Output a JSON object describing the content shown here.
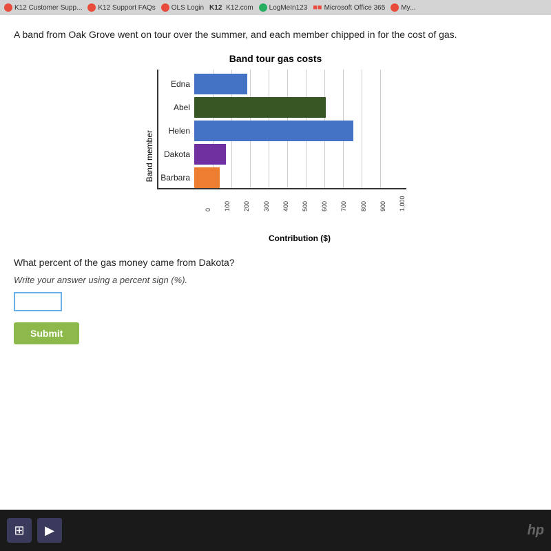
{
  "browser": {
    "tabs": [
      {
        "label": "K12 Customer Supp...",
        "icon": "k12-icon"
      },
      {
        "label": "K12 Support FAQs",
        "icon": "k12-icon2"
      },
      {
        "label": "OLS Login",
        "icon": "ols-icon"
      },
      {
        "label": "K12  K12.com",
        "icon": "k12-icon3"
      },
      {
        "label": "LogMeIn123",
        "icon": "logmein-icon"
      },
      {
        "label": "Microsoft Office 365",
        "icon": "ms-icon"
      },
      {
        "label": "My...",
        "icon": "my-icon"
      }
    ]
  },
  "problem": {
    "text": "A band from Oak Grove went on tour over the summer, and each member chipped in for the cost of gas."
  },
  "chart": {
    "title": "Band tour gas costs",
    "y_axis_label": "Band member",
    "x_axis_label": "Contribution ($)",
    "x_ticks": [
      "0",
      "100",
      "200",
      "300",
      "400",
      "500",
      "600",
      "700",
      "800",
      "900",
      "1,000"
    ],
    "members": [
      {
        "name": "Edna",
        "value": 250,
        "color": "#4472c4",
        "max": 1000
      },
      {
        "name": "Abel",
        "value": 620,
        "color": "#375623",
        "max": 1000
      },
      {
        "name": "Helen",
        "value": 750,
        "color": "#4472c4",
        "max": 1000
      },
      {
        "name": "Dakota",
        "value": 150,
        "color": "#7030a0",
        "max": 1000
      },
      {
        "name": "Barbara",
        "value": 120,
        "color": "#ed7d31",
        "max": 1000
      }
    ]
  },
  "question": {
    "text": "What percent of the gas money came from Dakota?",
    "instruction": "Write your answer using a percent sign (%).",
    "input_placeholder": "",
    "submit_label": "Submit"
  },
  "taskbar": {
    "icons": [
      "⊞",
      "▶"
    ]
  }
}
